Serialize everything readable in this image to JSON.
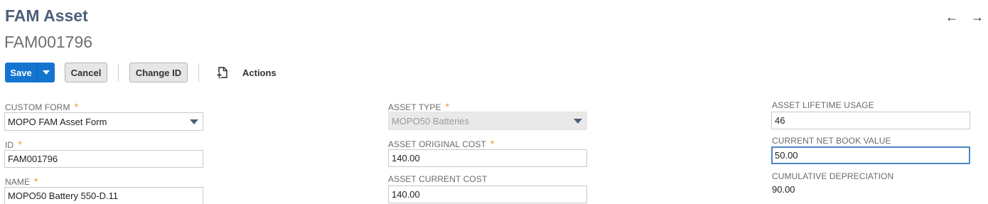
{
  "page": {
    "title": "FAM Asset",
    "record_id": "FAM001796"
  },
  "nav": {
    "prev_icon": "arrow-left-icon",
    "next_icon": "arrow-right-icon",
    "prev_glyph": "←",
    "next_glyph": "→"
  },
  "toolbar": {
    "save_label": "Save",
    "cancel_label": "Cancel",
    "change_id_label": "Change ID",
    "actions_label": "Actions"
  },
  "form": {
    "custom_form": {
      "label": "CUSTOM FORM",
      "required": "*",
      "value": "MOPO FAM Asset Form"
    },
    "id": {
      "label": "ID",
      "required": "*",
      "value": "FAM001796"
    },
    "name": {
      "label": "NAME",
      "required": "*",
      "value": "MOPO50 Battery 550-D.11"
    },
    "asset_type": {
      "label": "ASSET TYPE",
      "required": "*",
      "value": "MOPO50 Batteries"
    },
    "asset_original_cost": {
      "label": "ASSET ORIGINAL COST",
      "required": "*",
      "value": "140.00"
    },
    "asset_current_cost": {
      "label": "ASSET CURRENT COST",
      "value": "140.00"
    },
    "asset_lifetime_usage": {
      "label": "ASSET LIFETIME USAGE",
      "value": "46"
    },
    "current_net_book_value": {
      "label": "CURRENT NET BOOK VALUE",
      "value": "50.00"
    },
    "cumulative_depreciation": {
      "label": "CUMULATIVE DEPRECIATION",
      "value": "90.00"
    }
  },
  "colors": {
    "primary": "#1475d1",
    "title": "#4d5f79",
    "required": "#e0a31b",
    "focus": "#4a86c5"
  }
}
